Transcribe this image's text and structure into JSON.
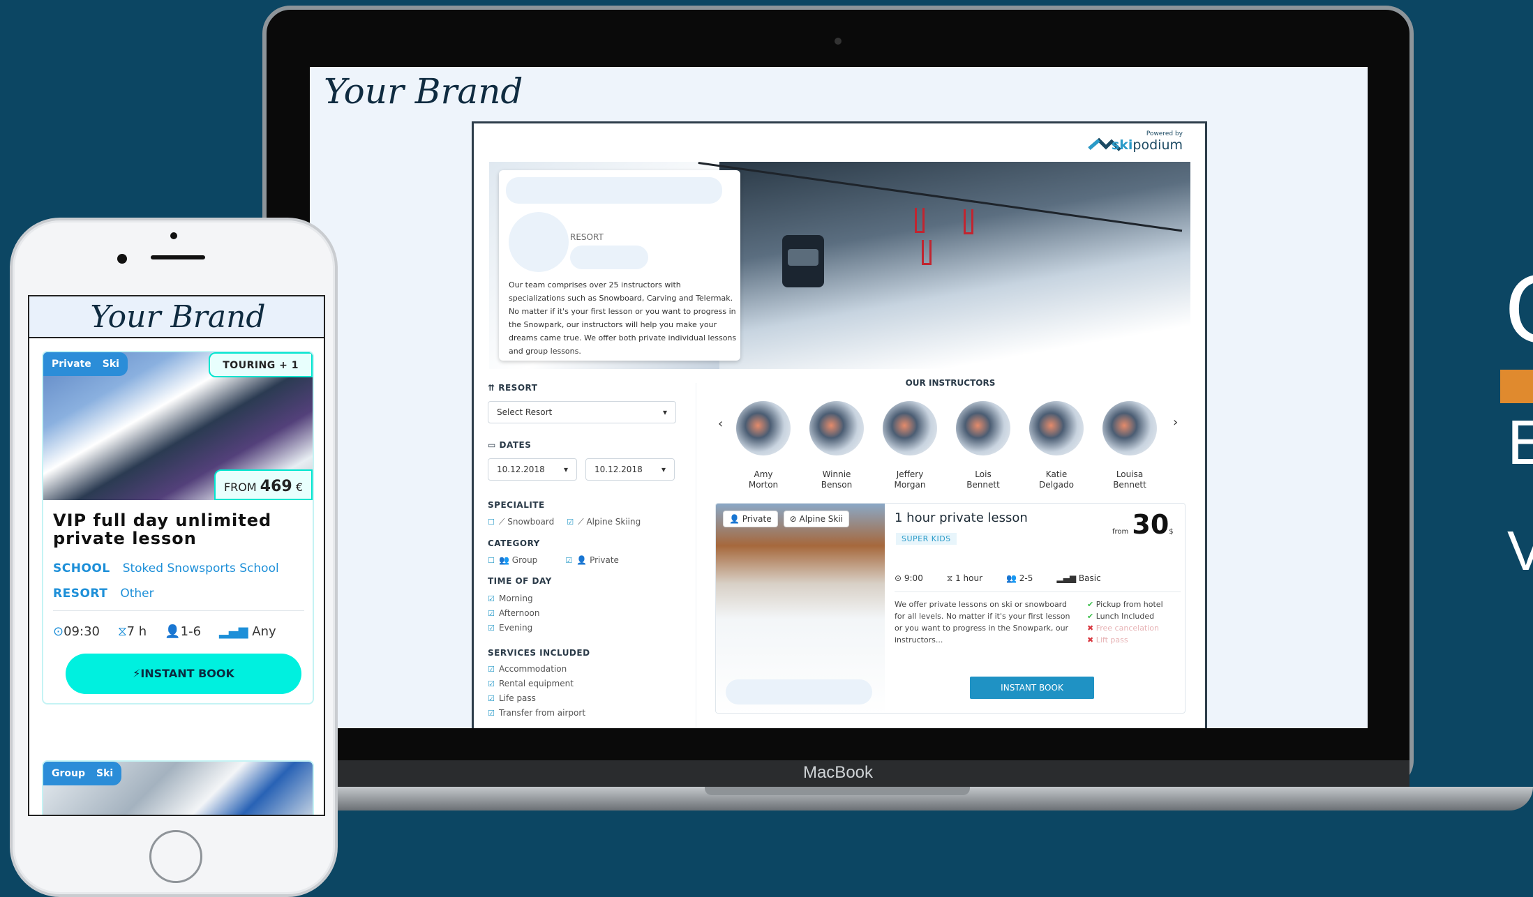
{
  "right_side": {
    "c": "C",
    "e": "E",
    "v": "V"
  },
  "laptop": {
    "label": "MacBook",
    "brand": "Your Brand",
    "powered_by": "Powered by",
    "provider_ski": "ski",
    "provider_podium": "podium",
    "card": {
      "resort_label": "RESORT",
      "description": "Our team comprises over 25 instructors with specializations such as Snowboard, Carving and Telermak. No matter if it's your first lesson or you want to progress in the Snowpark, our instructors will help you make your dreams came true. We offer both private individual lessons and group lessons."
    },
    "filters": {
      "resort_title": "RESORT",
      "resort_select": "Select Resort",
      "dates_title": "DATES",
      "date_from": "10.12.2018",
      "date_to": "10.12.2018",
      "speciality_title": "SPECIALITE",
      "speciality": [
        "Snowboard",
        "Alpine Skiing"
      ],
      "category_title": "CATEGORY",
      "category": [
        "Group",
        "Private"
      ],
      "time_title": "TIME OF DAY",
      "time": [
        "Morning",
        "Afternoon",
        "Evening"
      ],
      "services_title": "SERVICES INCLUDED",
      "services": [
        "Accommodation",
        "Rental equipment",
        "Life pass",
        "Transfer from airport"
      ]
    },
    "instructors_title": "OUR INSTRUCTORS",
    "instructors": [
      {
        "first": "Amy",
        "last": "Morton"
      },
      {
        "first": "Winnie",
        "last": "Benson"
      },
      {
        "first": "Jeffery",
        "last": "Morgan"
      },
      {
        "first": "Lois",
        "last": "Bennett"
      },
      {
        "first": "Katie",
        "last": "Delgado"
      },
      {
        "first": "Louisa",
        "last": "Bennett"
      }
    ],
    "lesson": {
      "tag1": "Private",
      "tag2": "Alpine Skii",
      "title": "1 hour private lesson",
      "badge": "SUPER KIDS",
      "from": "from",
      "price": "30",
      "currency": "$",
      "time": "9:00",
      "duration": "1 hour",
      "group": "2-5",
      "level": "Basic",
      "description": "We offer private lessons on ski or snowboard for all levels. No matter if it's your first lesson or you want to progress in the Snowpark, our instructors...",
      "includes": [
        {
          "text": "Pickup from hotel",
          "ok": true
        },
        {
          "text": "Lunch Included",
          "ok": true
        },
        {
          "text": "Free cancelation",
          "ok": false
        },
        {
          "text": "Lift pass",
          "ok": false
        }
      ],
      "book": "INSTANT BOOK"
    }
  },
  "phone": {
    "brand": "Your Brand",
    "tag1": "Private",
    "tag2": "Ski",
    "touring": "TOURING + 1",
    "from_label": "FROM",
    "price": "469",
    "currency": "€",
    "title": "VIP full day unlimited private lesson",
    "school_label": "SCHOOL",
    "school": "Stoked Snowsports School",
    "resort_label": "RESORT",
    "resort": "Other",
    "time": "09:30",
    "duration": "7 h",
    "group": "1-6",
    "level": "Any",
    "book": "INSTANT BOOK",
    "card2_tag1": "Group",
    "card2_tag2": "Ski"
  },
  "colors": {
    "background": "#0c4663",
    "accent_orange": "#e08a2e",
    "phone_cta": "#00f0df",
    "laptop_cta": "#1f92c4"
  }
}
